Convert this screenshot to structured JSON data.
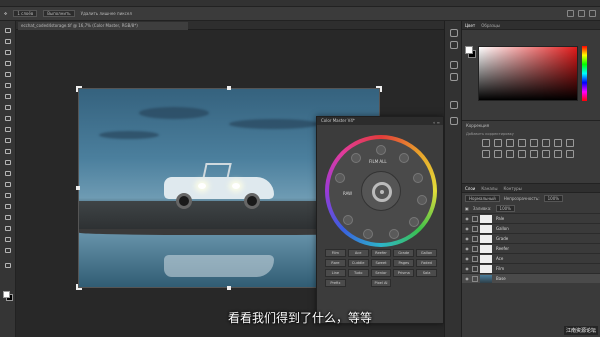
{
  "options_bar": {
    "layer_select": "1 слоёв",
    "transform_label": "Выполнить",
    "transform_right": "Удалить лишнее пиксел"
  },
  "document_tab": {
    "label": "ecchat_coded4storage.tif @ 16,7% (Color Master, RGB/8*)"
  },
  "plugin": {
    "title": "Color Master V4*",
    "dial_labels": {
      "top": "FILM ALL",
      "left": "RAW",
      "right": ""
    },
    "buttons": [
      "Film",
      "Ace",
      "Reefer",
      "Grade",
      "Gallon",
      "Rare",
      "Cuddle",
      "Sweet",
      "Pages",
      "Faded",
      "Line",
      "Tudo",
      "Senior",
      "Prisma",
      "Sala",
      "Prefix",
      "Pixel AI"
    ]
  },
  "subtitle": "看看我们得到了什么，等等",
  "right_panel": {
    "color_tabs": [
      "Цвет",
      "Образцы"
    ],
    "adjust_title": "Коррекция",
    "adjust_sub": "Добавить корректировку",
    "layer_tabs": [
      "Слои",
      "Каналы",
      "Контуры"
    ],
    "blend_mode": "Нормальный",
    "opacity_label": "Непрозрачность:",
    "opacity_value": "100%",
    "fill_label": "Заливка:",
    "fill_value": "100%",
    "layers": [
      "Pale",
      "Gallon",
      "Grade",
      "Reefer",
      "Ace",
      "Film",
      "Base"
    ]
  },
  "watermark": "江南资源论坛"
}
